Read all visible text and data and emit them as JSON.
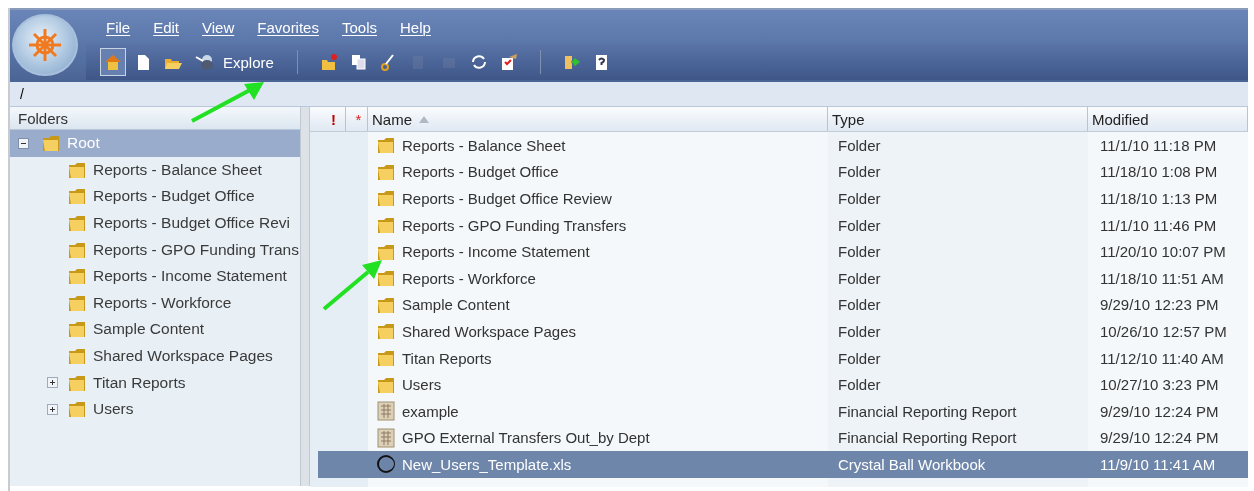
{
  "menu": [
    "File",
    "Edit",
    "View",
    "Favorites",
    "Tools",
    "Help"
  ],
  "toolbar": [
    {
      "kind": "home",
      "pressed": true,
      "disabled": false
    },
    {
      "kind": "document",
      "pressed": false,
      "disabled": false
    },
    {
      "kind": "open",
      "pressed": false,
      "disabled": false
    },
    {
      "kind": "explore",
      "label": "Explore",
      "pressed": false,
      "disabled": false
    },
    {
      "kind": "separator"
    },
    {
      "kind": "new-folder",
      "pressed": false,
      "disabled": false
    },
    {
      "kind": "copy",
      "pressed": false,
      "disabled": false
    },
    {
      "kind": "cut",
      "pressed": false,
      "disabled": false
    },
    {
      "kind": "paste",
      "pressed": false,
      "disabled": true
    },
    {
      "kind": "delete",
      "pressed": false,
      "disabled": true
    },
    {
      "kind": "refresh",
      "pressed": false,
      "disabled": false
    },
    {
      "kind": "properties",
      "pressed": false,
      "disabled": false
    },
    {
      "kind": "separator"
    },
    {
      "kind": "logout",
      "pressed": false,
      "disabled": false
    },
    {
      "kind": "help",
      "pressed": false,
      "disabled": false
    }
  ],
  "path": "/",
  "folders": {
    "title": "Folders",
    "tree": [
      {
        "label": "Root",
        "expandable": true,
        "expanded": true,
        "selected": true,
        "children": [
          {
            "label": "Reports - Balance Sheet",
            "expandable": false,
            "selected": false
          },
          {
            "label": "Reports - Budget Office",
            "expandable": false,
            "selected": false
          },
          {
            "label": "Reports - Budget Office Revi",
            "expandable": false,
            "selected": false
          },
          {
            "label": "Reports - GPO Funding Trans",
            "expandable": false,
            "selected": false
          },
          {
            "label": "Reports - Income Statement",
            "expandable": false,
            "selected": false
          },
          {
            "label": "Reports - Workforce",
            "expandable": false,
            "selected": false
          },
          {
            "label": "Sample Content",
            "expandable": false,
            "selected": false
          },
          {
            "label": "Shared Workspace Pages",
            "expandable": false,
            "selected": false
          },
          {
            "label": "Titan Reports",
            "expandable": true,
            "selected": false
          },
          {
            "label": "Users",
            "expandable": true,
            "selected": false
          }
        ]
      }
    ]
  },
  "table": {
    "columns": [
      {
        "label": "!",
        "kind": "flag"
      },
      {
        "label": "*",
        "kind": "flag"
      },
      {
        "label": "Name",
        "kind": "name",
        "sorted": true
      },
      {
        "label": "Type",
        "kind": "text",
        "sorted": false
      },
      {
        "label": "Modified",
        "kind": "text",
        "sorted": false
      }
    ],
    "rows": [
      {
        "name": "Reports - Balance Sheet",
        "kind": "folder",
        "type": "Folder",
        "modified": "11/1/10 11:18 PM",
        "selected": false
      },
      {
        "name": "Reports - Budget Office",
        "kind": "folder",
        "type": "Folder",
        "modified": "11/18/10 1:08 PM",
        "selected": false
      },
      {
        "name": "Reports - Budget Office Review",
        "kind": "folder",
        "type": "Folder",
        "modified": "11/18/10 1:13 PM",
        "selected": false
      },
      {
        "name": "Reports - GPO Funding Transfers",
        "kind": "folder",
        "type": "Folder",
        "modified": "11/1/10 11:46 PM",
        "selected": false
      },
      {
        "name": "Reports - Income Statement",
        "kind": "folder",
        "type": "Folder",
        "modified": "11/20/10 10:07 PM",
        "selected": false
      },
      {
        "name": "Reports - Workforce",
        "kind": "folder",
        "type": "Folder",
        "modified": "11/18/10 11:51 AM",
        "selected": false
      },
      {
        "name": "Sample Content",
        "kind": "folder",
        "type": "Folder",
        "modified": "9/29/10 12:23 PM",
        "selected": false
      },
      {
        "name": "Shared Workspace Pages",
        "kind": "folder",
        "type": "Folder",
        "modified": "10/26/10 12:57 PM",
        "selected": false
      },
      {
        "name": "Titan Reports",
        "kind": "folder",
        "type": "Folder",
        "modified": "11/12/10 11:40 AM",
        "selected": false
      },
      {
        "name": "Users",
        "kind": "folder",
        "type": "Folder",
        "modified": "10/27/10 3:23 PM",
        "selected": false
      },
      {
        "name": "example",
        "kind": "report",
        "type": "Financial Reporting Report",
        "modified": "9/29/10 12:24 PM",
        "selected": false
      },
      {
        "name": "GPO External Transfers Out_by Dept",
        "kind": "report",
        "type": "Financial Reporting Report",
        "modified": "9/29/10 12:24 PM",
        "selected": false
      },
      {
        "name": "New_Users_Template.xls",
        "kind": "workbook",
        "type": "Crystal Ball Workbook",
        "modified": "11/9/10 11:41 AM",
        "selected": true
      }
    ]
  }
}
